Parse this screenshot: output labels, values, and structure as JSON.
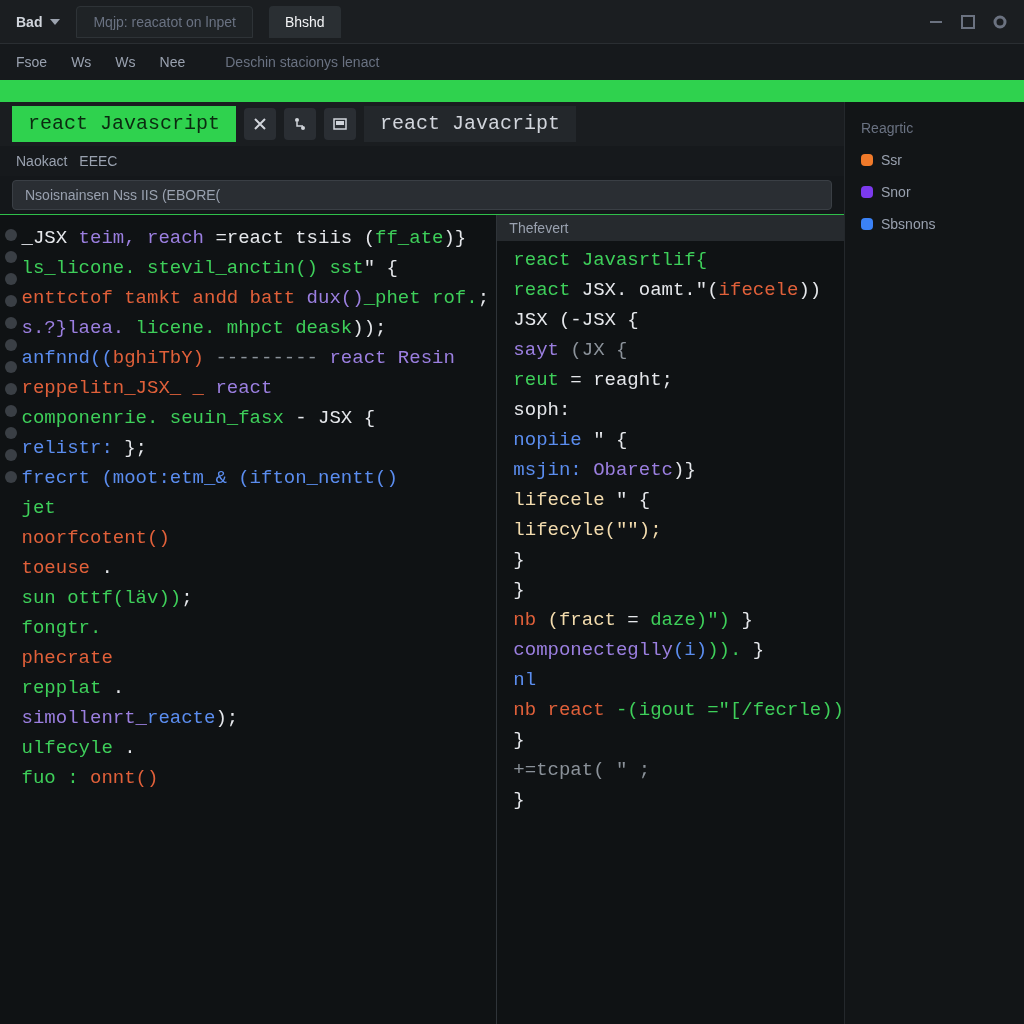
{
  "top_bar": {
    "menu_label": "Bad",
    "tabs": [
      {
        "label": "Mqjp: reacatot on lnpet",
        "selected": false
      },
      {
        "label": "Bhshd",
        "selected": true
      }
    ]
  },
  "menu": {
    "items": [
      "Fsoe",
      "Ws",
      "Ws",
      "Nee"
    ],
    "subtitle": "Deschin stacionys lenact"
  },
  "editor_tabs": [
    {
      "label": "react Javascript",
      "selected": true
    },
    {
      "label": "react Javacript",
      "selected": false
    }
  ],
  "breadcrumb": [
    "Naokact",
    "EEEC"
  ],
  "find_bar": {
    "value": "Nsoisnainsen Nss IIS (EBORE("
  },
  "left_pane": {
    "lines": [
      [
        {
          "kind": "plain",
          "text": "_JSX "
        },
        {
          "kind": "keyword",
          "text": "teim, reach "
        },
        {
          "kind": "plain",
          "text": "=react tsiis ("
        },
        {
          "kind": "string",
          "text": "ff_ate"
        },
        {
          "kind": "plain",
          "text": ")}"
        }
      ],
      [
        {
          "kind": "string",
          "text": "ls_licone. stevil_anctin() sst"
        },
        {
          "kind": "plain",
          "text": "\" {"
        }
      ],
      [
        {
          "kind": "func",
          "text": "enttctof tamkt andd batt "
        },
        {
          "kind": "keyword",
          "text": "dux()"
        },
        {
          "kind": "string",
          "text": "_phet rof."
        },
        {
          "kind": "plain",
          "text": ";"
        }
      ],
      [
        {
          "kind": "keyword",
          "text": "s.?}laea."
        },
        {
          "kind": "string",
          "text": " licene. mhpct deask"
        },
        {
          "kind": "plain",
          "text": "));"
        }
      ],
      [
        {
          "kind": "var",
          "text": "anfnnd(("
        },
        {
          "kind": "func",
          "text": "bghiTbY)"
        },
        {
          "kind": "dim",
          "text": " ---------"
        },
        {
          "kind": "keyword",
          "text": " react Resin"
        }
      ],
      [
        {
          "kind": "func",
          "text": "reppelitn_JSX_ _ "
        },
        {
          "kind": "keyword",
          "text": "react"
        }
      ],
      [
        {
          "kind": "string",
          "text": "componenrie. seuin_fasx"
        },
        {
          "kind": "plain",
          "text": " - JSX {"
        }
      ],
      [
        {
          "kind": "var",
          "text": "relistr: "
        },
        {
          "kind": "plain",
          "text": "};"
        }
      ],
      [
        {
          "kind": "var",
          "text": "frecrt (moot:etm_& (ifton_nentt()"
        }
      ],
      [
        {
          "kind": "string",
          "text": "jet"
        }
      ],
      [
        {
          "kind": "func",
          "text": "noorfcotent()"
        }
      ],
      [
        {
          "kind": "func",
          "text": "toeuse"
        },
        {
          "kind": "plain",
          "text": " ."
        }
      ],
      [
        {
          "kind": "string",
          "text": "sun ottf(läv))"
        },
        {
          "kind": "plain",
          "text": ";"
        }
      ],
      [
        {
          "kind": "string",
          "text": "fongtr."
        }
      ],
      [
        {
          "kind": "func",
          "text": "phecrate"
        }
      ],
      [
        {
          "kind": "string",
          "text": "repplat"
        },
        {
          "kind": "plain",
          "text": " ."
        }
      ],
      [
        {
          "kind": "keyword",
          "text": "simollenrt_"
        },
        {
          "kind": "var",
          "text": "reacte"
        },
        {
          "kind": "plain",
          "text": ");"
        }
      ],
      [
        {
          "kind": "string",
          "text": "ulfecyle"
        },
        {
          "kind": "plain",
          "text": " ."
        }
      ],
      [
        {
          "kind": "string",
          "text": "fuo :"
        },
        {
          "kind": "func",
          "text": " onnt()"
        }
      ]
    ]
  },
  "right_pane": {
    "header": "Thefevert",
    "lines": [
      [
        {
          "kind": "string",
          "text": "react Javasrtlif{"
        }
      ],
      [
        {
          "kind": "string",
          "text": "react "
        },
        {
          "kind": "plain",
          "text": "JSX. oamt.\"("
        },
        {
          "kind": "func",
          "text": "ifecele"
        },
        {
          "kind": "plain",
          "text": "))"
        }
      ],
      [
        {
          "kind": "plain",
          "text": "JSX (-JSX {"
        }
      ],
      [
        {
          "kind": "keyword",
          "text": "sayt"
        },
        {
          "kind": "dim",
          "text": " (JX {"
        }
      ],
      [
        {
          "kind": "string",
          "text": "reut"
        },
        {
          "kind": "plain",
          "text": " = reaght;"
        }
      ],
      [
        {
          "kind": "plain",
          "text": "soph:"
        }
      ],
      [
        {
          "kind": "var",
          "text": "nopiie"
        },
        {
          "kind": "plain",
          "text": " \" {"
        }
      ],
      [
        {
          "kind": "var",
          "text": "msjin: "
        },
        {
          "kind": "keyword",
          "text": "Obaretc"
        },
        {
          "kind": "plain",
          "text": ")}"
        }
      ],
      [
        {
          "kind": "name",
          "text": "lifecele"
        },
        {
          "kind": "plain",
          "text": " \" {"
        }
      ],
      [
        {
          "kind": "name",
          "text": "lifecyle(\"\");"
        }
      ],
      [
        {
          "kind": "plain",
          "text": "}"
        }
      ],
      [
        {
          "kind": "plain",
          "text": "}"
        }
      ],
      [
        {
          "kind": "func",
          "text": "nb "
        },
        {
          "kind": "name",
          "text": "(fract"
        },
        {
          "kind": "plain",
          "text": " = "
        },
        {
          "kind": "string",
          "text": "daze)\")"
        },
        {
          "kind": "plain",
          "text": " }"
        }
      ],
      [
        {
          "kind": "keyword",
          "text": "componecteglly"
        },
        {
          "kind": "var",
          "text": "(i)"
        },
        {
          "kind": "string",
          "text": "))."
        },
        {
          "kind": "plain",
          "text": " }"
        }
      ],
      [
        {
          "kind": "var",
          "text": "nl"
        }
      ],
      [
        {
          "kind": "func",
          "text": "nb react "
        },
        {
          "kind": "string",
          "text": "-(igout =\"[/fecrle))"
        }
      ],
      [
        {
          "kind": "plain",
          "text": "}"
        }
      ],
      [
        {
          "kind": "dim",
          "text": "+=tcpat( \" ;"
        }
      ],
      [
        {
          "kind": "plain",
          "text": "}"
        }
      ]
    ]
  },
  "outline": {
    "title": "Reagrtic",
    "items": [
      {
        "label": "Ssr",
        "color": "#f07a2a"
      },
      {
        "label": "Snor",
        "color": "#7c3aed"
      },
      {
        "label": "Sbsnons",
        "color": "#3b82f6"
      }
    ]
  }
}
